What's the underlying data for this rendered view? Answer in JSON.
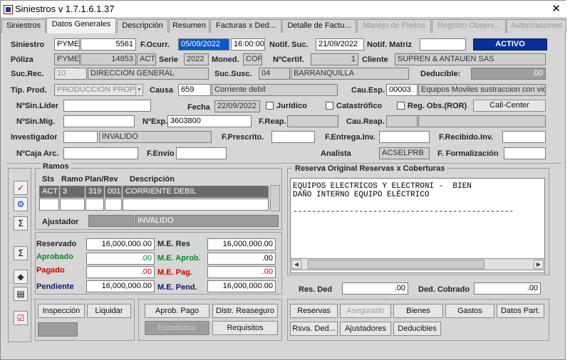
{
  "window": {
    "title": "Siniestros v  1.7.1.6.1.37",
    "close_glyph": "✕"
  },
  "tabs": [
    {
      "label": "Siniestros"
    },
    {
      "label": "Datos Generales"
    },
    {
      "label": "Descripción"
    },
    {
      "label": "Resumen"
    },
    {
      "label": "Facturas x Ded..."
    },
    {
      "label": "Detalle de Factu..."
    },
    {
      "label": "Manejo de Pleitos"
    },
    {
      "label": "Registro Observ..."
    },
    {
      "label": "Autorizaciones"
    }
  ],
  "header": {
    "siniestro_label": "Siniestro",
    "siniestro_ramo": "PYME",
    "siniestro_num": "5561",
    "f_ocurr_label": "F.Ocurr.",
    "f_ocurr_date": "05/09/2022",
    "f_ocurr_time": "16:00:00",
    "notif_suc_label": "Notif. Suc.",
    "notif_suc": "21/09/2022",
    "notif_matriz_label": "Notif. Matriz",
    "notif_matriz": "",
    "status": "ACTIVO",
    "poliza_label": "Póliza",
    "poliza_ramo": "PYME",
    "poliza_num": "14853",
    "poliza_sts": "ACT",
    "serie_label": "Serie",
    "serie": "2022",
    "moned_label": "Moned.",
    "moned": "COP",
    "ncertif_label": "NºCertif.",
    "ncertif": "1",
    "cliente_label": "Cliente",
    "cliente": "SUPREN & ANTAUEN SAS",
    "sucrec_label": "Suc.Rec.",
    "sucrec_code": "10",
    "sucrec_name": "DIRECCION GENERAL",
    "sucsusc_label": "Suc.Susc.",
    "sucsusc_code": "04",
    "sucsusc_name": "BARRANQUILLA",
    "deducible_label": "Deducible:",
    "deducible": ".00",
    "tipprod_label": "Tip. Prod.",
    "tipprod": "PRODUCCION PROPIA",
    "causa_label": "Causa",
    "causa_code": "659",
    "causa_name": "Corriente debil",
    "cauesp_label": "Cau.Esp.",
    "cauesp_code": "00003",
    "cauesp_name": "Equipos Moviles sustraccion con vio",
    "nsinlider_label": "NºSin.Líder",
    "nsinlider": "",
    "fecha_label": "Fecha",
    "fecha": "22/09/2022",
    "juridico_label": "Jurídico",
    "catastrofico_label": "Catastrófico",
    "regobs_label": "Reg. Obs.(ROR)",
    "callcenter_label": "Call-Center",
    "nsinmig_label": "NºSin.Mig.",
    "nsinmig": "",
    "nexp_label": "NºExp.",
    "nexp": "3603800",
    "freap_label": "F.Reap.",
    "freap": "",
    "caureap_label": "Cau.Reap.",
    "caureap_code": "",
    "caureap_name": "",
    "investigador_label": "Investigador",
    "investigador_code": "",
    "investigador_name": "INVALIDO",
    "fprescrito_label": "F.Prescrito.",
    "fprescrito": "",
    "fentrega_label": "F.Entrega.Inv.",
    "fentrega": "",
    "frecibido_label": "F.Recibido.Inv.",
    "frecibido": "",
    "ncaja_label": "NºCaja Arc.",
    "ncaja": "",
    "fenvio_label": "F.Envío",
    "fenvio": "",
    "analista_label": "Analista",
    "analista": "ACSELPRB",
    "fformalizacion_label": "F. Formalización",
    "fformalizacion": ""
  },
  "ramos": {
    "title": "Ramos",
    "col_sts": "Sts",
    "col_ramo": "Ramo",
    "col_plan": "Plan/Rev",
    "col_desc": "Descripción",
    "row_sts": "ACT",
    "row_ramo": "3",
    "row_plan": "319",
    "row_rev": "001",
    "row_desc": "CORRIENTE DEBIL",
    "ajustador_label": "Ajustador",
    "ajustador_code": "",
    "ajustador_name": "INVALIDO"
  },
  "reserva_original": {
    "title": "Reserva Original Reservas x Coberturas",
    "text": "EQUIPOS ELECTRICOS Y ELECTRONI -  BIEN\nDAÑO INTERNO EQUIPO ELÉCTRICO\n\n-----------------------------------------------"
  },
  "montos": {
    "reservado_label": "Reservado",
    "reservado": "16,000,000.00",
    "aprobado_label": "Aprobado",
    "aprobado": ".00",
    "pagado_label": "Pagado",
    "pagado": ".00",
    "pendiente_label": "Pendiente",
    "pendiente": "16,000,000.00",
    "me_res_label": "M.E. Res",
    "me_res": "16,000,000.00",
    "me_aprob_label": "M.E. Aprob.",
    "me_aprob": ".00",
    "me_pag_label": "M.E. Pag.",
    "me_pag": ".00",
    "me_pend_label": "M.E. Pend.",
    "me_pend": "16,000,000.00",
    "res_ded_label": "Res. Ded",
    "res_ded": ".00",
    "ded_cobrado_label": "Ded. Cobrado",
    "ded_cobrado": ".00"
  },
  "buttons": {
    "inspeccion": "Inspección",
    "liquidar": "Liquidar",
    "aprob_pago": "Aprob. Pago",
    "distr_reaseguro": "Distr. Reaseguro",
    "estadistica": "Estadística",
    "requisitos": "Requisitos",
    "reservas": "Reservas",
    "asegurado": "Asegurado",
    "bienes": "Bienes",
    "gastos": "Gastos",
    "datos_part": "Datos Part.",
    "rsva_ded": "Rsva. Ded...",
    "ajustadores": "Ajustadores",
    "deducibles": "Deducibles"
  },
  "colors": {
    "status_bg": "#0a2f9a",
    "selection": "#0a57c7",
    "green_text": "#00892b",
    "red_text": "#d20000",
    "navy_text": "#0d1a6e"
  }
}
